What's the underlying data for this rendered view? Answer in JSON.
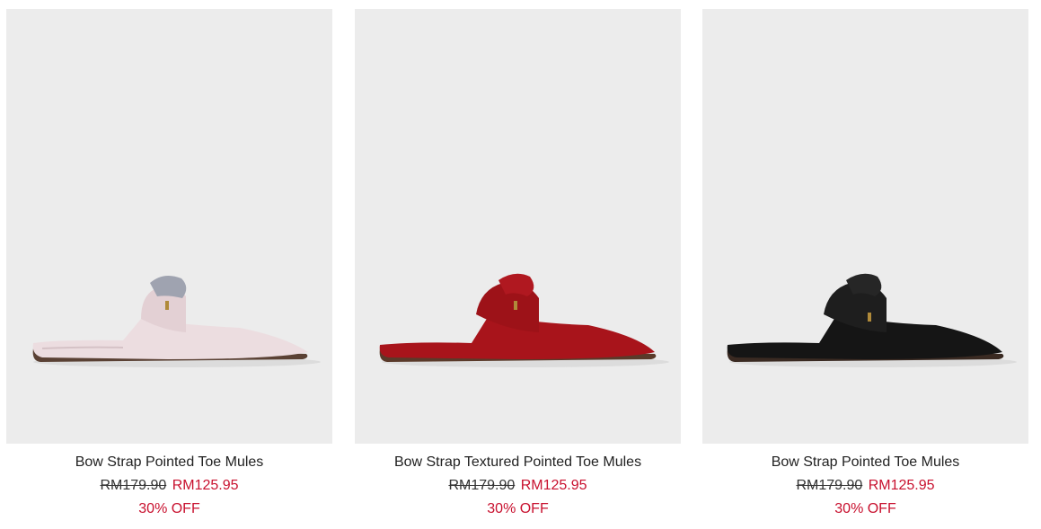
{
  "products": [
    {
      "name": "Bow Strap Pointed Toe Mules",
      "original_price": "RM179.90",
      "sale_price": "RM125.95",
      "discount": "30% OFF",
      "color": "#ecdde0"
    },
    {
      "name": "Bow Strap Textured Pointed Toe Mules",
      "original_price": "RM179.90",
      "sale_price": "RM125.95",
      "discount": "30% OFF",
      "color": "#a8141b"
    },
    {
      "name": "Bow Strap Pointed Toe Mules",
      "original_price": "RM179.90",
      "sale_price": "RM125.95",
      "discount": "30% OFF",
      "color": "#151515"
    }
  ],
  "colors": {
    "price_sale": "#c8102e",
    "image_bg": "#ececec"
  }
}
